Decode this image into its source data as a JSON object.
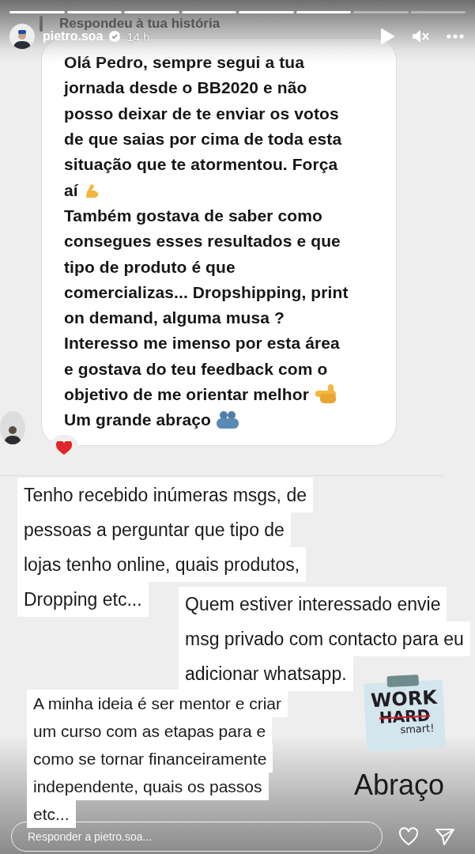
{
  "progress": [
    {
      "viewed": true
    },
    {
      "viewed": true
    },
    {
      "viewed": true
    },
    {
      "viewed": true
    },
    {
      "viewed": true
    },
    {
      "viewed": true
    },
    {
      "viewed": false
    },
    {
      "viewed": false
    }
  ],
  "reply_header": "Respondeu à tua história",
  "header": {
    "username": "pietro.soa",
    "verified": true,
    "time": "14 h"
  },
  "message": {
    "lines": [
      "Olá Pedro, sempre segui a tua",
      "jornada desde o BB2020 e não",
      "posso deixar de te enviar os votos",
      "de que saias por cima de toda esta",
      "situação que te atormentou. Força",
      "aí",
      "Também gostava de saber como",
      "consegues esses resultados e que",
      "tipo de produto é que",
      "comercializas... Dropshipping, print",
      "on demand, alguma musa ?",
      "Interesso me imenso por esta área",
      "e gostava do teu feedback com o",
      "objetivo de me orientar melhor",
      "Um grande abraço"
    ]
  },
  "captions": [
    {
      "lines": [
        "Tenho recebido inúmeras msgs, de",
        "pessoas a perguntar que tipo de",
        "lojas tenho online, quais produtos,",
        "Dropping etc..."
      ]
    },
    {
      "lines": [
        "Quem estiver interessado envie",
        "msg privado com contacto para eu",
        "adicionar whatsapp."
      ]
    },
    {
      "lines": [
        "A minha ideia é ser mentor e criar",
        "um curso com as etapas para  e",
        "como se tornar financeiramente",
        "independente, quais os passos",
        "etc..."
      ]
    }
  ],
  "sticker": {
    "lines": [
      "WORK",
      "HARD",
      "smart!"
    ]
  },
  "closing": "Abraço",
  "reply_field": {
    "placeholder": "Responder a pietro.soa..."
  }
}
